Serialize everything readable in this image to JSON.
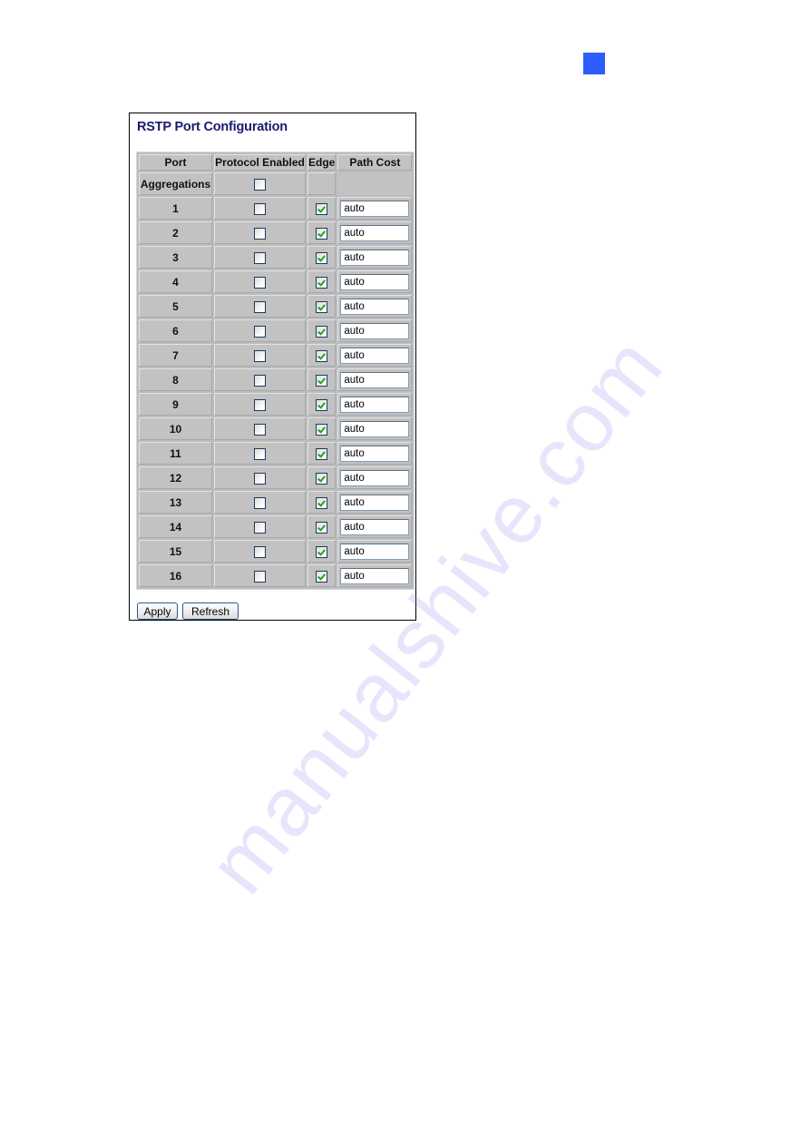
{
  "page": {
    "marker_color": "#2f5cff",
    "watermark": "manualshive.com"
  },
  "panel": {
    "title": "RSTP Port Configuration",
    "columns": [
      "Port",
      "Protocol Enabled",
      "Edge",
      "Path Cost"
    ],
    "aggregations": {
      "label": "Aggregations",
      "protocol_enabled": false
    },
    "rows": [
      {
        "port": "1",
        "protocol_enabled": false,
        "edge": true,
        "path_cost": "auto"
      },
      {
        "port": "2",
        "protocol_enabled": false,
        "edge": true,
        "path_cost": "auto"
      },
      {
        "port": "3",
        "protocol_enabled": false,
        "edge": true,
        "path_cost": "auto"
      },
      {
        "port": "4",
        "protocol_enabled": false,
        "edge": true,
        "path_cost": "auto"
      },
      {
        "port": "5",
        "protocol_enabled": false,
        "edge": true,
        "path_cost": "auto"
      },
      {
        "port": "6",
        "protocol_enabled": false,
        "edge": true,
        "path_cost": "auto"
      },
      {
        "port": "7",
        "protocol_enabled": false,
        "edge": true,
        "path_cost": "auto"
      },
      {
        "port": "8",
        "protocol_enabled": false,
        "edge": true,
        "path_cost": "auto"
      },
      {
        "port": "9",
        "protocol_enabled": false,
        "edge": true,
        "path_cost": "auto"
      },
      {
        "port": "10",
        "protocol_enabled": false,
        "edge": true,
        "path_cost": "auto"
      },
      {
        "port": "11",
        "protocol_enabled": false,
        "edge": true,
        "path_cost": "auto"
      },
      {
        "port": "12",
        "protocol_enabled": false,
        "edge": true,
        "path_cost": "auto"
      },
      {
        "port": "13",
        "protocol_enabled": false,
        "edge": true,
        "path_cost": "auto"
      },
      {
        "port": "14",
        "protocol_enabled": false,
        "edge": true,
        "path_cost": "auto"
      },
      {
        "port": "15",
        "protocol_enabled": false,
        "edge": true,
        "path_cost": "auto"
      },
      {
        "port": "16",
        "protocol_enabled": false,
        "edge": true,
        "path_cost": "auto"
      }
    ],
    "buttons": {
      "apply": "Apply",
      "refresh": "Refresh"
    }
  }
}
